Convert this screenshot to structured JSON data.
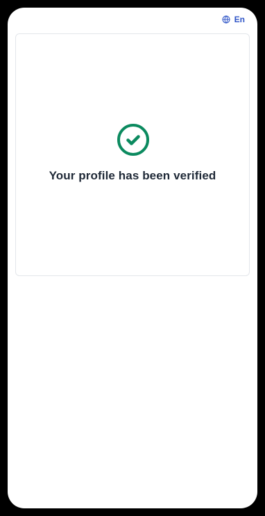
{
  "header": {
    "language_label": "En",
    "language_icon": "globe-icon"
  },
  "card": {
    "status_icon": "check-circle-icon",
    "message": "Your profile has been verified"
  },
  "colors": {
    "accent": "#2f55c7",
    "success": "#0b8a5f",
    "text": "#1f2937",
    "card_border": "#e3e6ea",
    "device_frame": "#000000",
    "background": "#ffffff"
  }
}
